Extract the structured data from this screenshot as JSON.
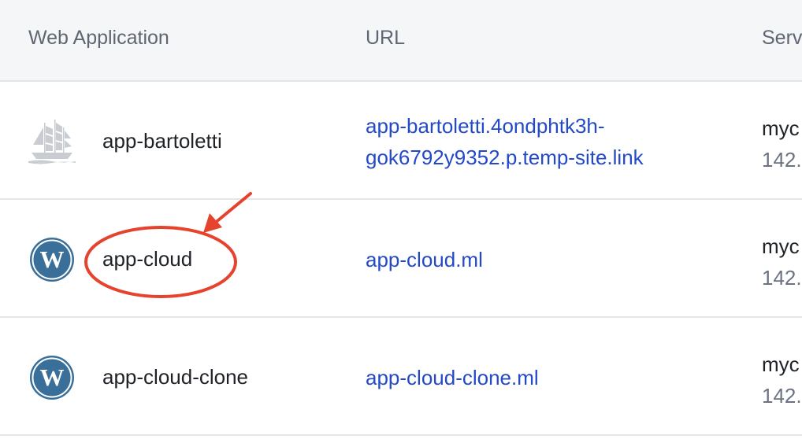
{
  "header": {
    "web_application": "Web Application",
    "url": "URL",
    "server": "Serv"
  },
  "rows": [
    {
      "name": "app-bartoletti",
      "icon": "sailboat-icon",
      "url_line1": "app-bartoletti.4ondphtk3h-",
      "url_line2": "gok6792y9352.p.temp-site.link",
      "server_name": "myc",
      "server_ip": "142."
    },
    {
      "name": "app-cloud",
      "icon": "wordpress-icon",
      "url": "app-cloud.ml",
      "server_name": "myc",
      "server_ip": "142."
    },
    {
      "name": "app-cloud-clone",
      "icon": "wordpress-icon",
      "url": "app-cloud-clone.ml",
      "server_name": "myc",
      "server_ip": "142."
    }
  ],
  "colors": {
    "link": "#2349c7",
    "wordpress": "#3a6f99",
    "annotation": "#e5432e",
    "header_bg": "#f5f6f8"
  }
}
